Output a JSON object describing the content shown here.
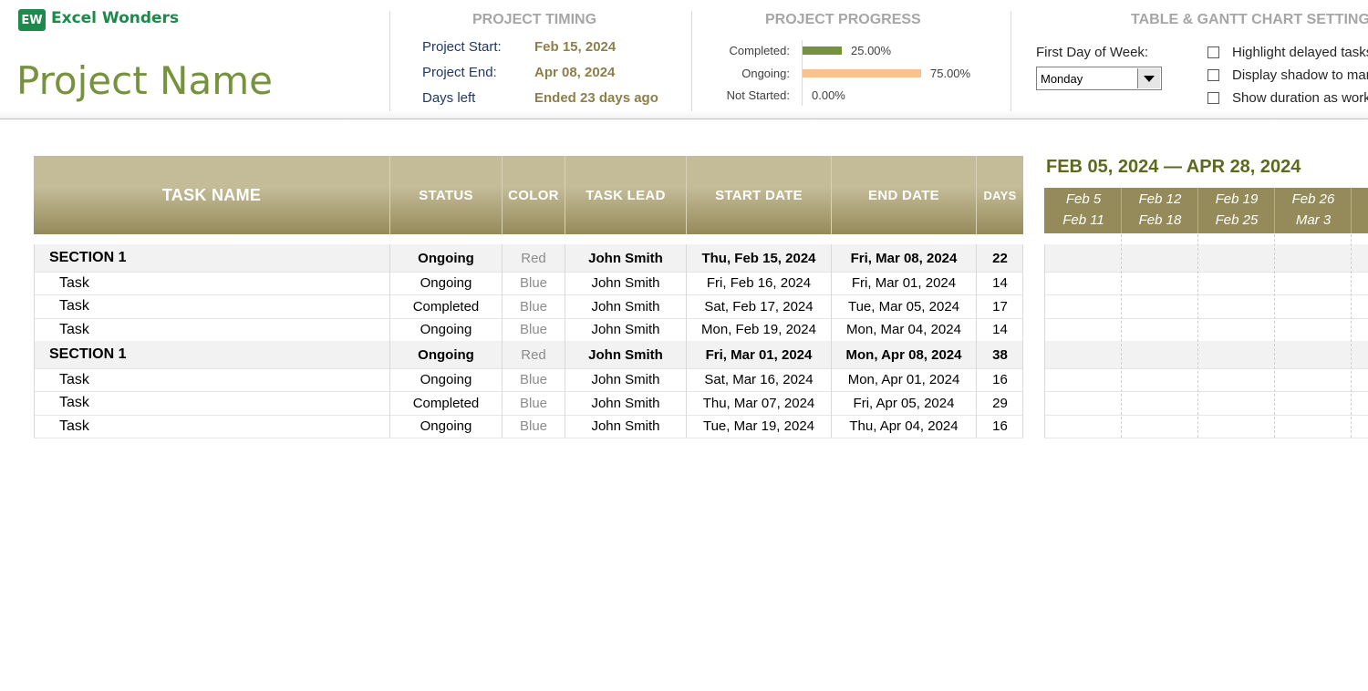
{
  "brand": {
    "badge": "EW",
    "name": "Excel Wonders"
  },
  "project": {
    "name": "Project Name"
  },
  "timing": {
    "title": "PROJECT TIMING",
    "start_label": "Project Start:",
    "start_value": "Feb 15, 2024",
    "end_label": "Project End:",
    "end_value": "Apr 08, 2024",
    "left_label": "Days left",
    "left_value": "Ended 23 days ago"
  },
  "progress": {
    "title": "PROJECT PROGRESS",
    "items": [
      {
        "label": "Completed:",
        "value": 25.0,
        "pct_text": "25.00%",
        "color": "#76923c"
      },
      {
        "label": "Ongoing:",
        "value": 75.0,
        "pct_text": "75.00%",
        "color": "#f8c194"
      },
      {
        "label": "Not Started:",
        "value": 0.0,
        "pct_text": "0.00%",
        "color": "#bfbfbf"
      }
    ]
  },
  "settings": {
    "title": "TABLE & GANTT CHART SETTINGS",
    "first_day_label": "First Day of Week:",
    "first_day_value": "Monday",
    "options": [
      {
        "label": "Highlight delayed tasks",
        "checked": false
      },
      {
        "label": "Display shadow to mark",
        "checked": false
      },
      {
        "label": "Show duration as working days",
        "checked": false
      }
    ]
  },
  "table": {
    "headers": {
      "task": "TASK NAME",
      "status": "STATUS",
      "color": "COLOR",
      "lead": "TASK LEAD",
      "start": "START DATE",
      "end": "END DATE",
      "days": "DAYS"
    },
    "rows": [
      {
        "type": "section",
        "name": "SECTION 1",
        "status": "Ongoing",
        "color": "Red",
        "lead": "John Smith",
        "start": "Thu, Feb 15, 2024",
        "end": "Fri, Mar 08, 2024",
        "days": "22"
      },
      {
        "type": "task",
        "name": "Task",
        "status": "Ongoing",
        "color": "Blue",
        "lead": "John Smith",
        "start": "Fri, Feb 16, 2024",
        "end": "Fri, Mar 01, 2024",
        "days": "14"
      },
      {
        "type": "task",
        "name": "Task",
        "status": "Completed",
        "color": "Blue",
        "lead": "John Smith",
        "start": "Sat, Feb 17, 2024",
        "end": "Tue, Mar 05, 2024",
        "days": "17"
      },
      {
        "type": "task",
        "name": "Task",
        "status": "Ongoing",
        "color": "Blue",
        "lead": "John Smith",
        "start": "Mon, Feb 19, 2024",
        "end": "Mon, Mar 04, 2024",
        "days": "14"
      },
      {
        "type": "section",
        "name": "SECTION 1",
        "status": "Ongoing",
        "color": "Red",
        "lead": "John Smith",
        "start": "Fri, Mar 01, 2024",
        "end": "Mon, Apr 08, 2024",
        "days": "38"
      },
      {
        "type": "task",
        "name": "Task",
        "status": "Ongoing",
        "color": "Blue",
        "lead": "John Smith",
        "start": "Sat, Mar 16, 2024",
        "end": "Mon, Apr 01, 2024",
        "days": "16"
      },
      {
        "type": "task",
        "name": "Task",
        "status": "Completed",
        "color": "Blue",
        "lead": "John Smith",
        "start": "Thu, Mar 07, 2024",
        "end": "Fri, Apr 05, 2024",
        "days": "29"
      },
      {
        "type": "task",
        "name": "Task",
        "status": "Ongoing",
        "color": "Blue",
        "lead": "John Smith",
        "start": "Tue, Mar 19, 2024",
        "end": "Thu, Apr 04, 2024",
        "days": "16"
      }
    ]
  },
  "gantt": {
    "range": "FEB 05, 2024 — APR 28, 2024",
    "weeks": [
      {
        "from": "Feb 5",
        "to": "Feb 11"
      },
      {
        "from": "Feb 12",
        "to": "Feb 18"
      },
      {
        "from": "Feb 19",
        "to": "Feb 25"
      },
      {
        "from": "Feb 26",
        "to": "Mar 3"
      }
    ],
    "colors": {
      "red": "#ff3b3b",
      "blue": "#6fd3f7",
      "grey": "#bfbfbf"
    }
  }
}
